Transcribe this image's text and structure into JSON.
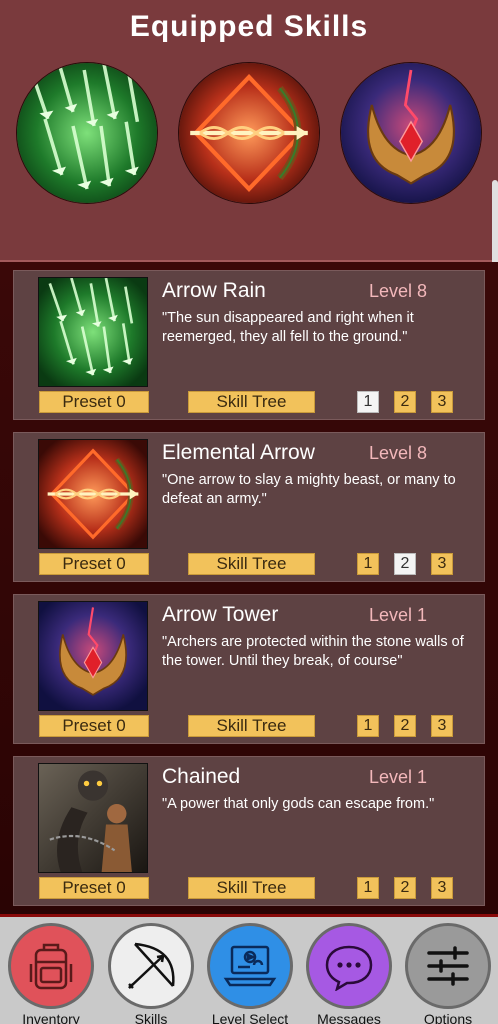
{
  "header": {
    "title": "Equipped Skills"
  },
  "equipped": [
    {
      "icon": "arrow-rain-icon"
    },
    {
      "icon": "elemental-arrow-icon"
    },
    {
      "icon": "arrow-tower-icon"
    }
  ],
  "skills": [
    {
      "name": "Arrow Rain",
      "level": "Level 8",
      "desc": "\"The sun disappeared and right when it reemerged, they all fell to the ground.\"",
      "preset": "Preset 0",
      "tree": "Skill Tree",
      "nums": [
        "1",
        "2",
        "3"
      ],
      "active": 0
    },
    {
      "name": "Elemental Arrow",
      "level": "Level 8",
      "desc": "\"One arrow to slay a mighty beast, or many to defeat an army.\"",
      "preset": "Preset 0",
      "tree": "Skill Tree",
      "nums": [
        "1",
        "2",
        "3"
      ],
      "active": 1
    },
    {
      "name": "Arrow Tower",
      "level": "Level 1",
      "desc": "\"Archers are protected within the stone walls of the tower. Until they break, of course\"",
      "preset": "Preset 0",
      "tree": "Skill Tree",
      "nums": [
        "1",
        "2",
        "3"
      ],
      "active": -1
    },
    {
      "name": "Chained",
      "level": "Level 1",
      "desc": "\"A power that only gods can escape from.\"",
      "preset": "Preset 0",
      "tree": "Skill Tree",
      "nums": [
        "1",
        "2",
        "3"
      ],
      "active": -1
    }
  ],
  "nav": [
    {
      "label": "Inventory",
      "icon": "backpack-icon",
      "color": "#e0525a"
    },
    {
      "label": "Skills",
      "icon": "bow-icon",
      "color": "#eeeeee"
    },
    {
      "label": "Level Select",
      "icon": "laptop-icon",
      "color": "#2f8fe6"
    },
    {
      "label": "Messages",
      "icon": "chat-bubble-icon",
      "color": "#a659e3"
    },
    {
      "label": "Options",
      "icon": "sliders-icon",
      "color": "#9a9a9a"
    }
  ]
}
